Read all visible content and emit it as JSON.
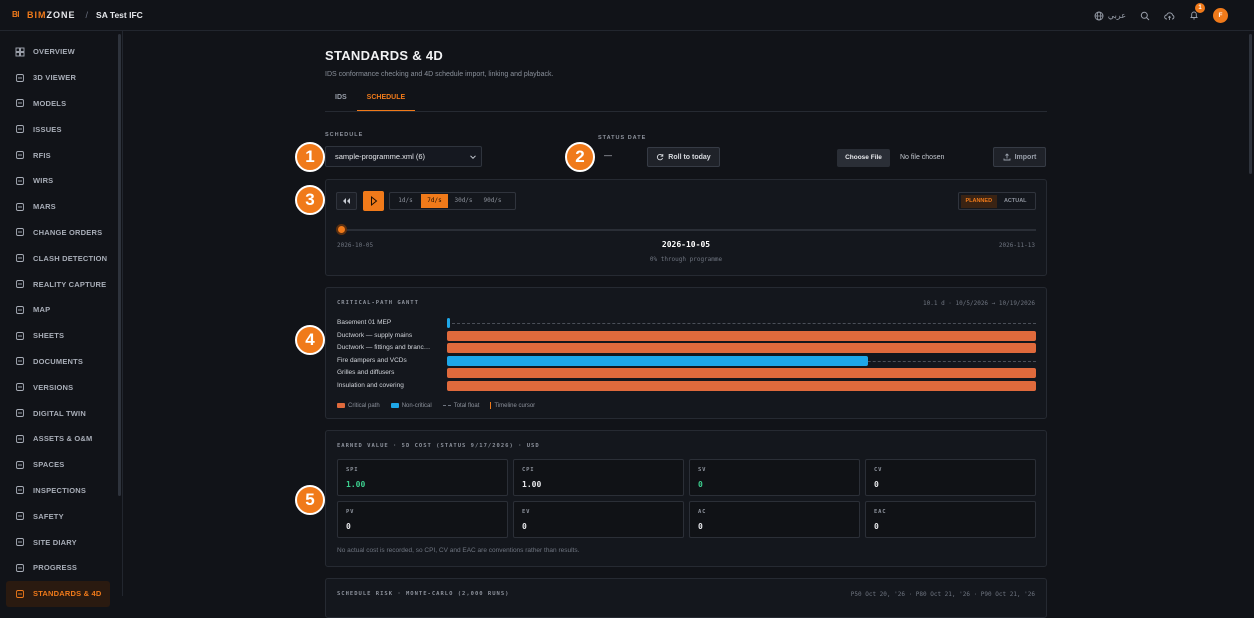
{
  "brand": {
    "mark": "BI",
    "name_prefix": "BIM",
    "name_suffix": "ZONE",
    "accent": "#f07a1a"
  },
  "header": {
    "separator": "/",
    "project": "SA Test IFC",
    "language": "عربي",
    "notifications_count": "1",
    "avatar_initial": "F"
  },
  "sidebar": {
    "items": [
      {
        "label": "OVERVIEW",
        "icon": "grid-icon"
      },
      {
        "label": "3D VIEWER",
        "icon": "axes-icon"
      },
      {
        "label": "MODELS",
        "icon": "boxes-icon"
      },
      {
        "label": "ISSUES",
        "icon": "warning-icon"
      },
      {
        "label": "RFIS",
        "icon": "message-icon"
      },
      {
        "label": "WIRS",
        "icon": "clipboard-icon"
      },
      {
        "label": "MARS",
        "icon": "file-icon"
      },
      {
        "label": "CHANGE ORDERS",
        "icon": "edit-icon"
      },
      {
        "label": "CLASH DETECTION",
        "icon": "bolt-icon"
      },
      {
        "label": "REALITY CAPTURE",
        "icon": "camera-icon"
      },
      {
        "label": "MAP",
        "icon": "map-icon"
      },
      {
        "label": "SHEETS",
        "icon": "sheets-icon"
      },
      {
        "label": "DOCUMENTS",
        "icon": "folder-icon"
      },
      {
        "label": "VERSIONS",
        "icon": "branch-icon"
      },
      {
        "label": "DIGITAL TWIN",
        "icon": "twin-icon"
      },
      {
        "label": "ASSETS & O&M",
        "icon": "wrench-icon"
      },
      {
        "label": "SPACES",
        "icon": "building-icon"
      },
      {
        "label": "INSPECTIONS",
        "icon": "checklist-icon"
      },
      {
        "label": "SAFETY",
        "icon": "helmet-icon"
      },
      {
        "label": "SITE DIARY",
        "icon": "book-icon"
      },
      {
        "label": "PROGRESS",
        "icon": "trend-icon"
      },
      {
        "label": "STANDARDS & 4D",
        "icon": "shield-check-icon"
      }
    ]
  },
  "page": {
    "title": "STANDARDS & 4D",
    "subtitle": "IDS conformance checking and 4D schedule import, linking and playback.",
    "tabs": [
      "IDS",
      "SCHEDULE"
    ]
  },
  "schedule": {
    "schedule_label": "SCHEDULE",
    "selected": "sample-programme.xml (6)",
    "status_date_label": "STATUS DATE",
    "status_date_value": "—",
    "roll_button": "Roll to today",
    "choose_file": "Choose File",
    "no_file": "No file chosen",
    "import_button": "Import"
  },
  "playback": {
    "speeds": [
      "1d/s",
      "7d/s",
      "30d/s",
      "90d/s"
    ],
    "modes": [
      "PLANNED",
      "ACTUAL"
    ],
    "start_date": "2026-10-05",
    "current_date": "2026-10-05",
    "end_date": "2026-11-13",
    "progress_text": "0% through programme",
    "progress_fraction": 0
  },
  "gantt": {
    "title": "CRITICAL-PATH GANTT",
    "range": "10.1 d · 10/5/2026 → 10/19/2026",
    "rows": [
      {
        "name": "Basement 01 MEP",
        "start": 0.0,
        "end": 0.005,
        "critical": false
      },
      {
        "name": "Ductwork — supply mains",
        "start": 0.0,
        "end": 1.0,
        "critical": true
      },
      {
        "name": "Ductwork — fittings and branc…",
        "start": 0.0,
        "end": 1.0,
        "critical": true
      },
      {
        "name": "Fire dampers and VCDs",
        "start": 0.0,
        "end": 0.715,
        "critical": false
      },
      {
        "name": "Grilles and diffusers",
        "start": 0.0,
        "end": 1.0,
        "critical": true
      },
      {
        "name": "Insulation and covering",
        "start": 0.0,
        "end": 1.0,
        "critical": true
      }
    ],
    "legend": [
      "Critical path",
      "Non-critical",
      "Total float",
      "Timeline cursor"
    ],
    "colors": {
      "critical": "#e06a3c",
      "noncritical": "#1ea7e8"
    }
  },
  "earned_value": {
    "title": "EARNED VALUE · 5D COST (STATUS 9/17/2026) · USD",
    "metrics": [
      {
        "key": "SPI",
        "value": "1.00",
        "good": true
      },
      {
        "key": "CPI",
        "value": "1.00",
        "good": false
      },
      {
        "key": "SV",
        "value": "0",
        "good": true
      },
      {
        "key": "CV",
        "value": "0",
        "good": false
      },
      {
        "key": "PV",
        "value": "0",
        "good": false
      },
      {
        "key": "EV",
        "value": "0",
        "good": false
      },
      {
        "key": "AC",
        "value": "0",
        "good": false
      },
      {
        "key": "EAC",
        "value": "0",
        "good": false
      }
    ],
    "note": "No actual cost is recorded, so CPI, CV and EAC are conventions rather than results."
  },
  "risk": {
    "title": "SCHEDULE RISK · MONTE-CARLO (2,000 RUNS)",
    "range": "P50 Oct 20, '26 · P80 Oct 21, '26 · P90 Oct 21, '26"
  },
  "callouts": [
    "1",
    "2",
    "3",
    "4",
    "5"
  ]
}
